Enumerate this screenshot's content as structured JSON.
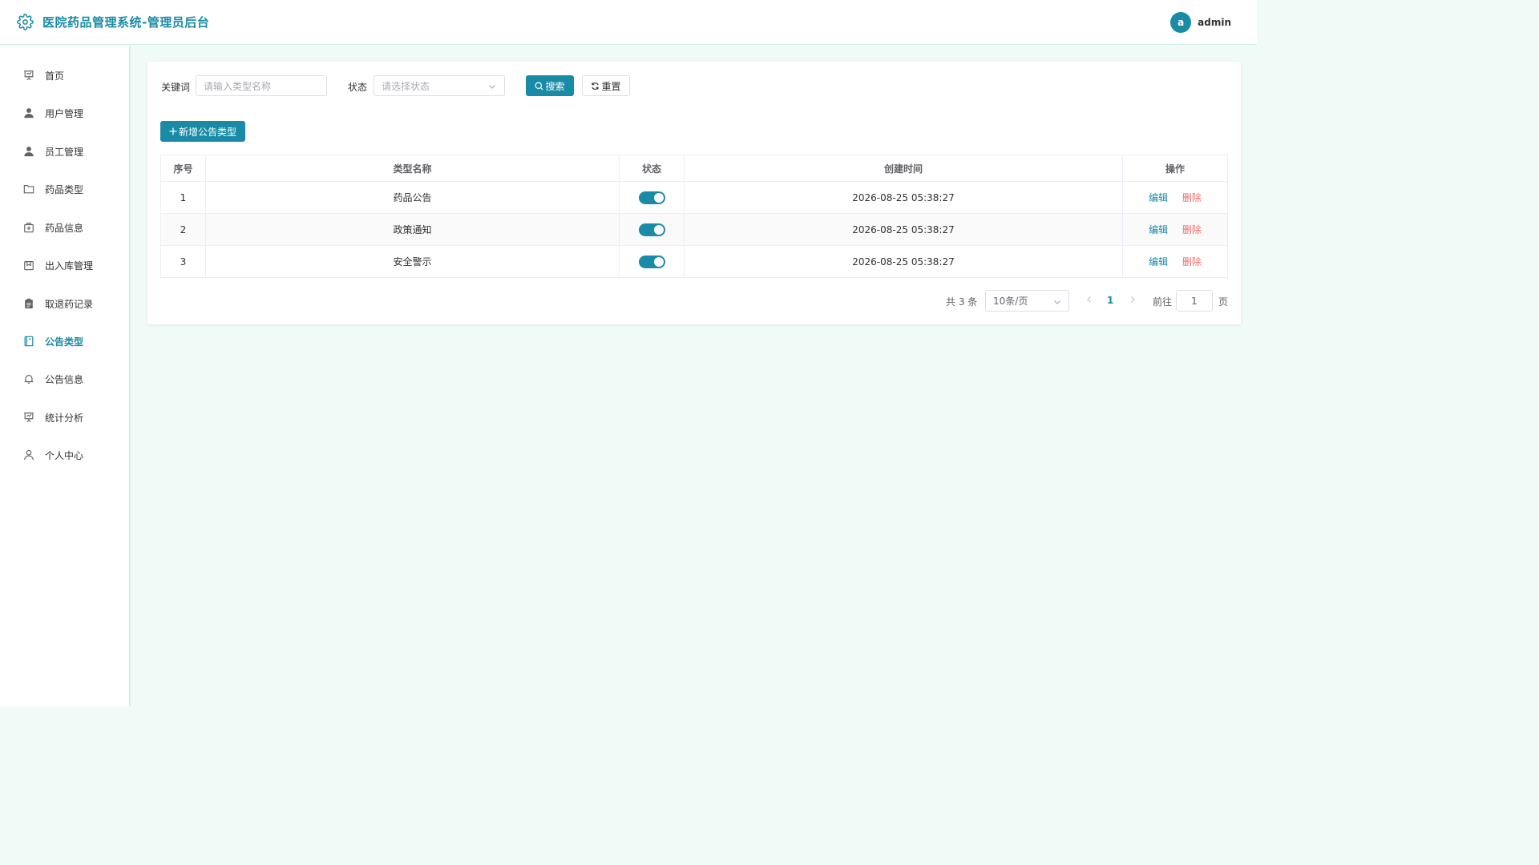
{
  "app": {
    "title": "医院药品管理系统-管理员后台"
  },
  "user": {
    "avatar_letter": "a",
    "name": "admin"
  },
  "sidebar": {
    "items": [
      {
        "label": "首页",
        "icon": "presentation-icon"
      },
      {
        "label": "用户管理",
        "icon": "user-icon"
      },
      {
        "label": "员工管理",
        "icon": "user-icon"
      },
      {
        "label": "药品类型",
        "icon": "folder-icon"
      },
      {
        "label": "药品信息",
        "icon": "medicine-box-icon"
      },
      {
        "label": "出入库管理",
        "icon": "box-icon"
      },
      {
        "label": "取退药记录",
        "icon": "clipboard-icon"
      },
      {
        "label": "公告类型",
        "icon": "notebook-icon",
        "active": true
      },
      {
        "label": "公告信息",
        "icon": "bell-icon"
      },
      {
        "label": "统计分析",
        "icon": "presentation-icon"
      },
      {
        "label": "个人中心",
        "icon": "user-outline-icon"
      }
    ]
  },
  "filter": {
    "keyword_label": "关键词",
    "keyword_placeholder": "请输入类型名称",
    "status_label": "状态",
    "status_placeholder": "请选择状态",
    "search_label": "搜索",
    "reset_label": "重置"
  },
  "add_button_label": "新增公告类型",
  "table": {
    "headers": {
      "index": "序号",
      "name": "类型名称",
      "status": "状态",
      "created": "创建时间",
      "actions": "操作"
    },
    "rows": [
      {
        "index": "1",
        "name": "药品公告",
        "status": true,
        "created": "2026-08-25 05:38:27"
      },
      {
        "index": "2",
        "name": "政策通知",
        "status": true,
        "created": "2026-08-25 05:38:27"
      },
      {
        "index": "3",
        "name": "安全警示",
        "status": true,
        "created": "2026-08-25 05:38:27"
      }
    ],
    "edit_label": "编辑",
    "delete_label": "删除"
  },
  "pagination": {
    "total_text": "共 3 条",
    "page_size": "10条/页",
    "current_page": "1",
    "goto_label": "前往",
    "goto_value": "1",
    "page_suffix": "页"
  },
  "colors": {
    "accent": "#1a8ba6",
    "danger": "#f56c6c",
    "background": "#f0fbf8"
  }
}
